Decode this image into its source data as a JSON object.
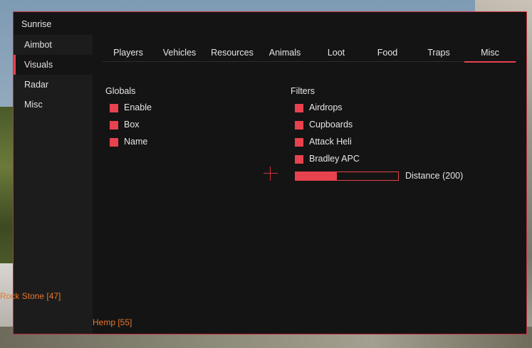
{
  "window": {
    "title": "Sunrise"
  },
  "colors": {
    "accent": "#e8424f",
    "esp_text": "#e8772a",
    "panel": "#141414",
    "sidebar": "#1c1c1c"
  },
  "sidebar": {
    "items": [
      {
        "label": "Aimbot",
        "active": false
      },
      {
        "label": "Visuals",
        "active": true
      },
      {
        "label": "Radar",
        "active": false
      },
      {
        "label": "Misc",
        "active": false
      }
    ]
  },
  "tabs": [
    {
      "label": "Players",
      "active": false
    },
    {
      "label": "Vehicles",
      "active": false
    },
    {
      "label": "Resources",
      "active": false
    },
    {
      "label": "Animals",
      "active": false
    },
    {
      "label": "Loot",
      "active": false
    },
    {
      "label": "Food",
      "active": false
    },
    {
      "label": "Traps",
      "active": false
    },
    {
      "label": "Misc",
      "active": true
    }
  ],
  "globals": {
    "title": "Globals",
    "options": [
      {
        "label": "Enable",
        "checked": true
      },
      {
        "label": "Box",
        "checked": true
      },
      {
        "label": "Name",
        "checked": true
      }
    ]
  },
  "filters": {
    "title": "Filters",
    "options": [
      {
        "label": "Airdrops",
        "checked": true
      },
      {
        "label": "Cupboards",
        "checked": true
      },
      {
        "label": "Attack Heli",
        "checked": true
      },
      {
        "label": "Bradley APC",
        "checked": true
      }
    ],
    "distance": {
      "label": "Distance (200)",
      "value": 200,
      "fill_fraction": 0.4
    }
  },
  "esp_labels": {
    "rock_stone": "Rock Stone [47]",
    "hemp": "Hemp [55]"
  },
  "icons": {
    "crosshair": "crosshair-icon"
  }
}
